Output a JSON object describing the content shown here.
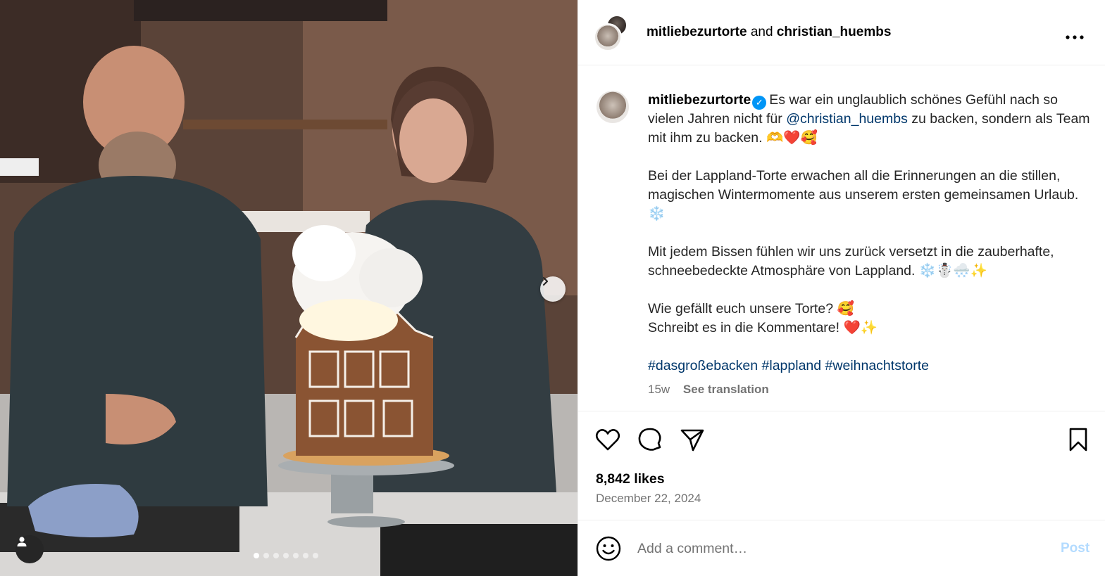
{
  "post": {
    "authors": {
      "primary": "mitliebezurtorte",
      "connector": "and",
      "collaborator": "christian_huembs"
    },
    "more_icon": "more-horizontal-icon",
    "caption": {
      "username": "mitliebezurtorte",
      "verified_icon": "verified-badge-icon",
      "p1_a": "Es war ein unglaublich schönes Gefühl nach so vielen Jahren nicht für ",
      "mention": "@christian_huembs",
      "p1_b": " zu backen, sondern als Team mit ihm zu backen. ",
      "p1_emoji": "🫶❤️🥰",
      "p2": "Bei der Lappland-Torte erwachen all die Erinnerungen an die stillen, magischen Wintermomente aus unserem ersten gemeinsamen Urlaub. ",
      "p2_emoji": "❄️",
      "p3": "Mit jedem Bissen fühlen wir uns zurück versetzt in die zauberhafte, schneebedeckte Atmosphäre von Lappland. ",
      "p3_emoji": "❄️☃️🌨️✨",
      "p4_line1": "Wie gefällt euch unsere Torte? ",
      "p4_line1_emoji": "🥰",
      "p4_line2": "Schreibt es in die Kommentare! ",
      "p4_line2_emoji": "❤️✨",
      "hashtags": [
        "#dasgroßebacken",
        "#lappland",
        "#weihnachtstorte"
      ],
      "age": "15w",
      "see_translation": "See translation"
    },
    "likes": "8,842 likes",
    "date": "December 22, 2024",
    "comment": {
      "placeholder": "Add a comment…",
      "post_label": "Post"
    },
    "carousel": {
      "total_slides": 7,
      "active_index": 0
    },
    "colors": {
      "link": "#00376b",
      "verified": "#0095f6",
      "post_disabled": "#b3dbff",
      "muted": "#737373"
    }
  }
}
